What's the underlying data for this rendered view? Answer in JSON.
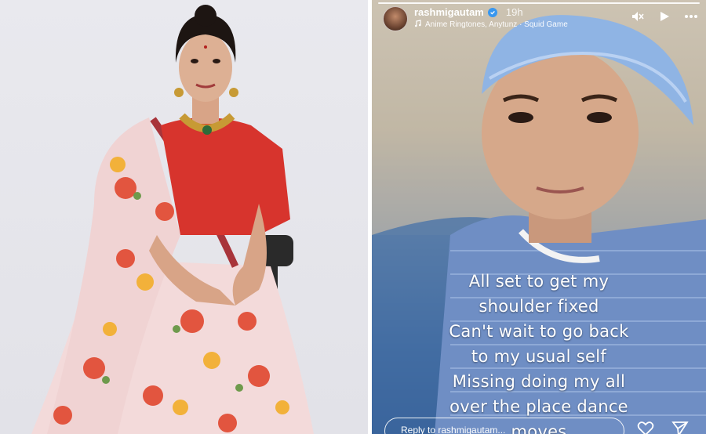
{
  "story": {
    "username": "rashmigautam",
    "time": "19h",
    "music": "Anime Ringtones, Anytunz · Squid Game",
    "caption_lines": [
      "All set to get my",
      "shoulder fixed",
      "Can't wait to go back",
      "to my usual self",
      "Missing doing my all",
      "over the place dance",
      "moves"
    ],
    "reply_placeholder": "Reply to rashmigautam..."
  },
  "icons": {
    "verified": "verified-badge-icon",
    "music": "music-note-icon",
    "mute": "muted-speaker-icon",
    "play": "play-icon",
    "more": "more-options-icon",
    "like": "heart-icon",
    "share": "send-icon"
  },
  "colors": {
    "verified_blue": "#3897f0",
    "caption_text": "#ffffff"
  }
}
